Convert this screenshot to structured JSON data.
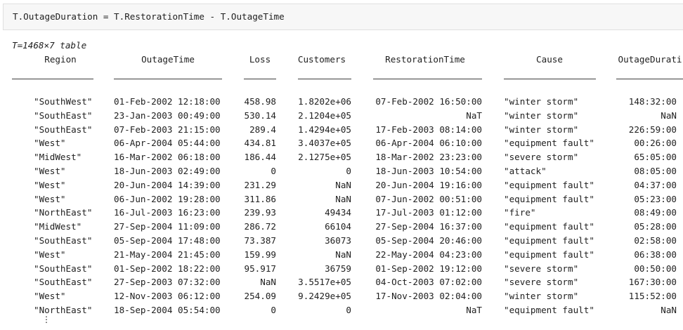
{
  "code": {
    "line": "T.OutageDuration = T.RestorationTime - T.OutageTime"
  },
  "table_info": "T=1468×7 table",
  "columns": [
    {
      "key": "region",
      "label": "Region"
    },
    {
      "key": "outage_time",
      "label": "OutageTime"
    },
    {
      "key": "loss",
      "label": "Loss"
    },
    {
      "key": "customers",
      "label": "Customers"
    },
    {
      "key": "restoration_time",
      "label": "RestorationTime"
    },
    {
      "key": "cause",
      "label": "Cause"
    },
    {
      "key": "outage_duration",
      "label": "OutageDurati"
    }
  ],
  "rows": [
    {
      "region": "\"SouthWest\"",
      "outage_time": "01-Feb-2002 12:18:00",
      "loss": "458.98",
      "customers": "1.8202e+06",
      "restoration_time": "07-Feb-2002 16:50:00",
      "cause": "\"winter storm\"",
      "outage_duration": "148:32:00"
    },
    {
      "region": "\"SouthEast\"",
      "outage_time": "23-Jan-2003 00:49:00",
      "loss": "530.14",
      "customers": "2.1204e+05",
      "restoration_time": "NaT",
      "cause": "\"winter storm\"",
      "outage_duration": "NaN"
    },
    {
      "region": "\"SouthEast\"",
      "outage_time": "07-Feb-2003 21:15:00",
      "loss": "289.4",
      "customers": "1.4294e+05",
      "restoration_time": "17-Feb-2003 08:14:00",
      "cause": "\"winter storm\"",
      "outage_duration": "226:59:00"
    },
    {
      "region": "\"West\"",
      "outage_time": "06-Apr-2004 05:44:00",
      "loss": "434.81",
      "customers": "3.4037e+05",
      "restoration_time": "06-Apr-2004 06:10:00",
      "cause": "\"equipment fault\"",
      "outage_duration": "00:26:00"
    },
    {
      "region": "\"MidWest\"",
      "outage_time": "16-Mar-2002 06:18:00",
      "loss": "186.44",
      "customers": "2.1275e+05",
      "restoration_time": "18-Mar-2002 23:23:00",
      "cause": "\"severe storm\"",
      "outage_duration": "65:05:00"
    },
    {
      "region": "\"West\"",
      "outage_time": "18-Jun-2003 02:49:00",
      "loss": "0",
      "customers": "0",
      "restoration_time": "18-Jun-2003 10:54:00",
      "cause": "\"attack\"",
      "outage_duration": "08:05:00"
    },
    {
      "region": "\"West\"",
      "outage_time": "20-Jun-2004 14:39:00",
      "loss": "231.29",
      "customers": "NaN",
      "restoration_time": "20-Jun-2004 19:16:00",
      "cause": "\"equipment fault\"",
      "outage_duration": "04:37:00"
    },
    {
      "region": "\"West\"",
      "outage_time": "06-Jun-2002 19:28:00",
      "loss": "311.86",
      "customers": "NaN",
      "restoration_time": "07-Jun-2002 00:51:00",
      "cause": "\"equipment fault\"",
      "outage_duration": "05:23:00"
    },
    {
      "region": "\"NorthEast\"",
      "outage_time": "16-Jul-2003 16:23:00",
      "loss": "239.93",
      "customers": "49434",
      "restoration_time": "17-Jul-2003 01:12:00",
      "cause": "\"fire\"",
      "outage_duration": "08:49:00"
    },
    {
      "region": "\"MidWest\"",
      "outage_time": "27-Sep-2004 11:09:00",
      "loss": "286.72",
      "customers": "66104",
      "restoration_time": "27-Sep-2004 16:37:00",
      "cause": "\"equipment fault\"",
      "outage_duration": "05:28:00"
    },
    {
      "region": "\"SouthEast\"",
      "outage_time": "05-Sep-2004 17:48:00",
      "loss": "73.387",
      "customers": "36073",
      "restoration_time": "05-Sep-2004 20:46:00",
      "cause": "\"equipment fault\"",
      "outage_duration": "02:58:00"
    },
    {
      "region": "\"West\"",
      "outage_time": "21-May-2004 21:45:00",
      "loss": "159.99",
      "customers": "NaN",
      "restoration_time": "22-May-2004 04:23:00",
      "cause": "\"equipment fault\"",
      "outage_duration": "06:38:00"
    },
    {
      "region": "\"SouthEast\"",
      "outage_time": "01-Sep-2002 18:22:00",
      "loss": "95.917",
      "customers": "36759",
      "restoration_time": "01-Sep-2002 19:12:00",
      "cause": "\"severe storm\"",
      "outage_duration": "00:50:00"
    },
    {
      "region": "\"SouthEast\"",
      "outage_time": "27-Sep-2003 07:32:00",
      "loss": "NaN",
      "customers": "3.5517e+05",
      "restoration_time": "04-Oct-2003 07:02:00",
      "cause": "\"severe storm\"",
      "outage_duration": "167:30:00"
    },
    {
      "region": "\"West\"",
      "outage_time": "12-Nov-2003 06:12:00",
      "loss": "254.09",
      "customers": "9.2429e+05",
      "restoration_time": "17-Nov-2003 02:04:00",
      "cause": "\"winter storm\"",
      "outage_duration": "115:52:00"
    },
    {
      "region": "\"NorthEast\"",
      "outage_time": "18-Sep-2004 05:54:00",
      "loss": "0",
      "customers": "0",
      "restoration_time": "NaT",
      "cause": "\"equipment fault\"",
      "outage_duration": "NaN"
    }
  ],
  "continuation_glyph": "⋮"
}
